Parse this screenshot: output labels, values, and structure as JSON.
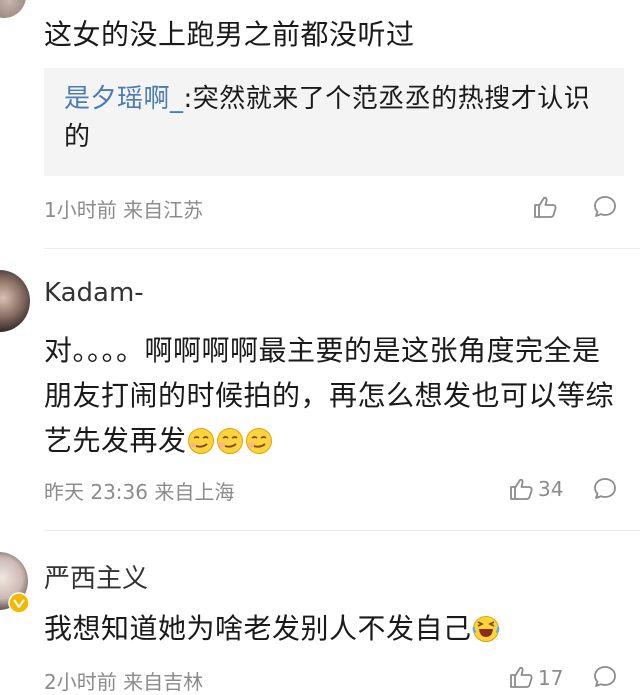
{
  "comments": [
    {
      "text": "这女的没上跑男之前都没听过",
      "reply": {
        "user": "是夕瑶啊_",
        "text": ":突然就来了个范丞丞的热搜才认识的"
      },
      "meta": "1小时前 来自江苏"
    },
    {
      "user": "Kadam-",
      "text": "对。。。。啊啊啊啊最主要的是这张角度完全是朋友打闹的时候拍的，再怎么想发也可以等综艺先发再发",
      "meta": "昨天 23:36 来自上海",
      "likes": "34"
    },
    {
      "user": "严西主义",
      "text": "我想知道她为啥老发别人不发自己",
      "meta": "2小时前 来自吉林",
      "likes": "17"
    }
  ],
  "icons": {
    "like": "thumbs-up-icon",
    "reply": "comment-bubble-icon",
    "emoji": "smirk-emoji",
    "laugh": "laughing-emoji",
    "verified": "verified-badge"
  },
  "colors": {
    "link": "#4a7bb4",
    "meta": "#8b8b8b",
    "quote_bg": "#f4f4f4",
    "badge": "#f5b800"
  }
}
